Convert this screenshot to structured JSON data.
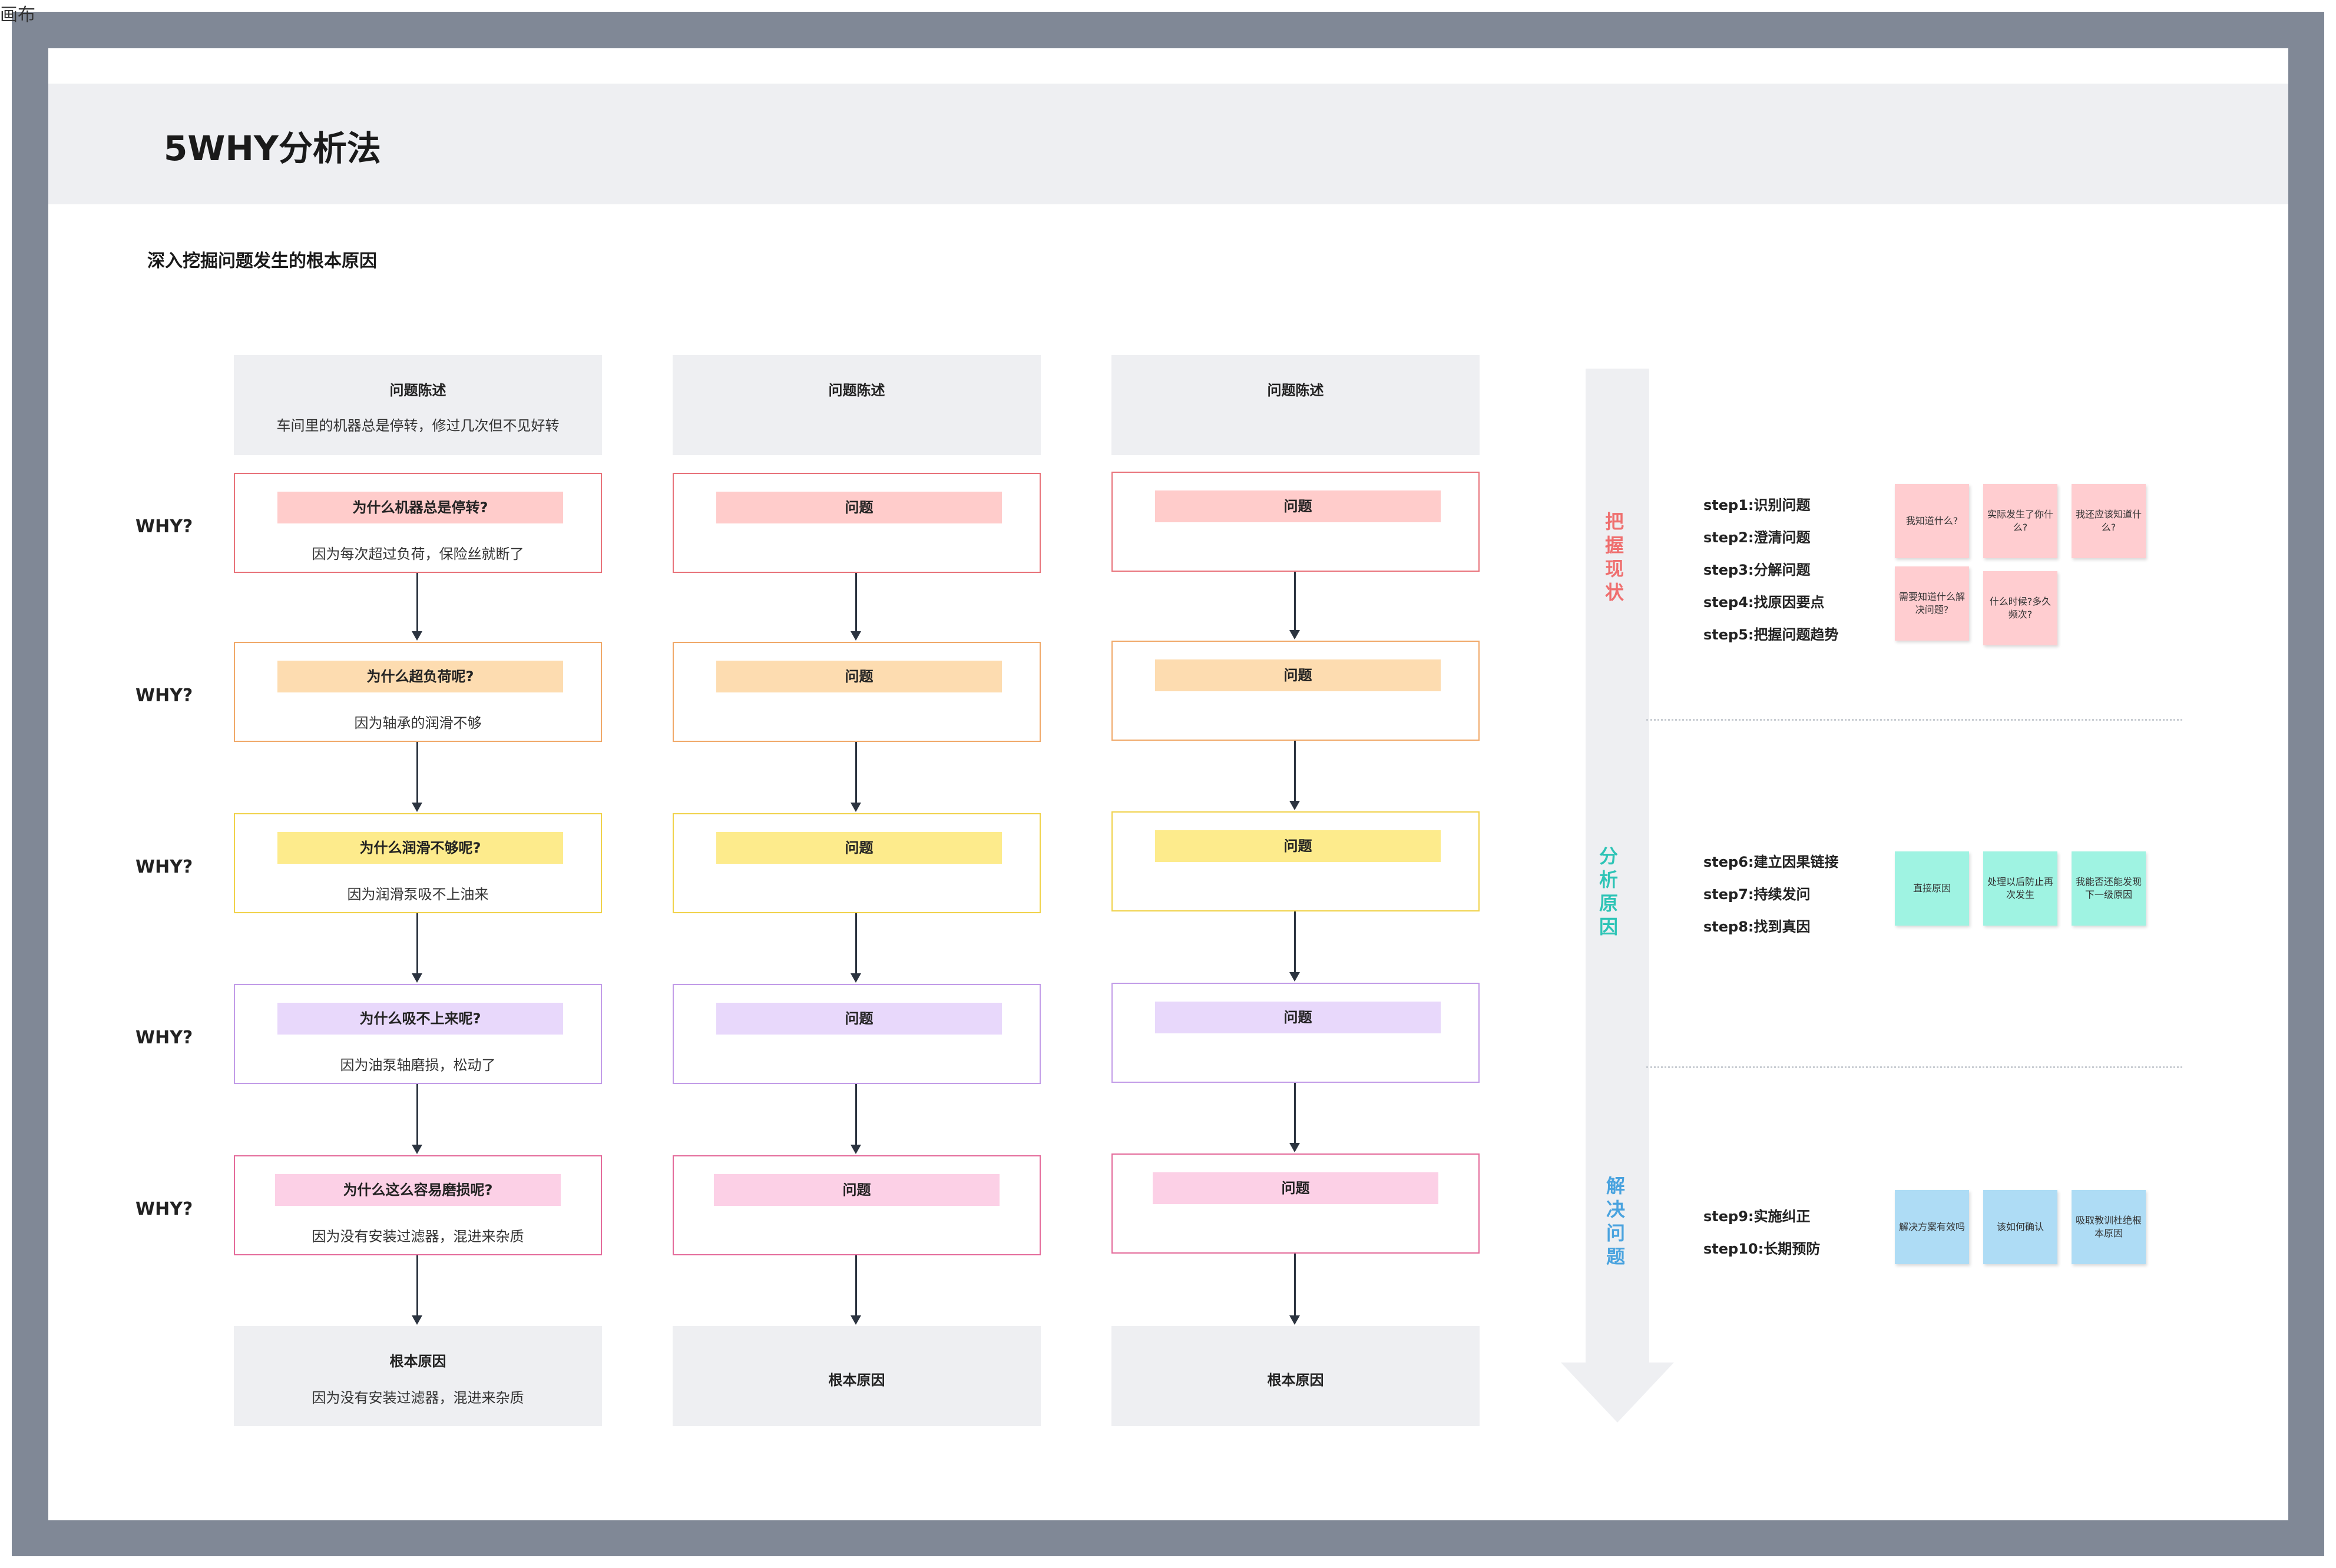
{
  "top_label": "画布",
  "title": "5WHY分析法",
  "subtitle": "深入挖掘问题发生的根本原因",
  "why_label": "WHY?",
  "columns": [
    {
      "statement_heading": "问题陈述",
      "statement_text": "车间里的机器总是停转，修过几次但不见好转",
      "questions": [
        {
          "q": "为什么机器总是停转?",
          "a": "因为每次超过负荷，保险丝就断了"
        },
        {
          "q": "为什么超负荷呢?",
          "a": "因为轴承的润滑不够"
        },
        {
          "q": "为什么润滑不够呢?",
          "a": "因为润滑泵吸不上油来"
        },
        {
          "q": "为什么吸不上来呢?",
          "a": "因为油泵轴磨损，松动了"
        },
        {
          "q": "为什么这么容易磨损呢?",
          "a": "因为没有安装过滤器，混进来杂质"
        }
      ],
      "root_heading": "根本原因",
      "root_text": "因为没有安装过滤器，混进来杂质"
    },
    {
      "statement_heading": "问题陈述",
      "statement_text": "",
      "questions": [
        {
          "q": "问题",
          "a": ""
        },
        {
          "q": "问题",
          "a": ""
        },
        {
          "q": "问题",
          "a": ""
        },
        {
          "q": "问题",
          "a": ""
        },
        {
          "q": "问题",
          "a": ""
        }
      ],
      "root_heading": "根本原因",
      "root_text": ""
    },
    {
      "statement_heading": "问题陈述",
      "statement_text": "",
      "questions": [
        {
          "q": "问题",
          "a": ""
        },
        {
          "q": "问题",
          "a": ""
        },
        {
          "q": "问题",
          "a": ""
        },
        {
          "q": "问题",
          "a": ""
        },
        {
          "q": "问题",
          "a": ""
        }
      ],
      "root_heading": "根本原因",
      "root_text": ""
    }
  ],
  "phases": [
    {
      "name": "把握现状",
      "color": "#ef6f6f"
    },
    {
      "name": "分析原因",
      "color": "#2ec4b6"
    },
    {
      "name": "解决问题",
      "color": "#4aa3df"
    }
  ],
  "steps": {
    "group1": [
      "step1:识别问题",
      "step2:澄清问题",
      "step3:分解问题",
      "step4:找原因要点",
      "step5:把握问题趋势"
    ],
    "group2": [
      "step6:建立因果链接",
      "step7:持续发问",
      "step8:找到真因"
    ],
    "group3": [
      "step9:实施纠正",
      "step10:长期预防"
    ]
  },
  "stickies": {
    "group1": [
      "我知道什么?",
      "实际发生了你什么?",
      "我还应该知道什么?",
      "需要知道什么解决问题?",
      "什么时候?多久频次?"
    ],
    "group2": [
      "直接原因",
      "处理以后防止再次发生",
      "我能否还能发现下一级原因"
    ],
    "group3": [
      "解决方案有效吗",
      "该如何确认",
      "吸取教训杜绝根本原因"
    ]
  }
}
